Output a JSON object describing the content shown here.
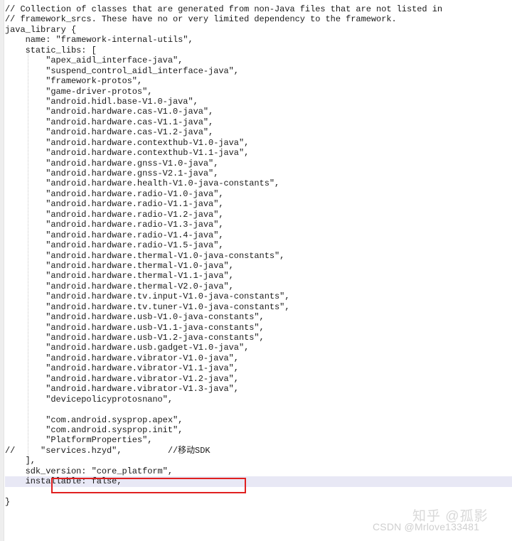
{
  "editor": {
    "language": "blueprint",
    "colors": {
      "background": "#ffffff",
      "text": "#1a1a1a",
      "gutter": "#eeeeee",
      "highlight_line": "#e8e8f5",
      "annotation_box": "#e02020",
      "indent_guide": "#c9c9c9",
      "watermark": "#d9d9d9"
    },
    "highlighted_line_index": 46,
    "annotation": {
      "type": "red-rectangle",
      "target_line_index": 46,
      "note": "commented-out services.hzyd entry"
    },
    "lines": [
      "// Collection of classes that are generated from non-Java files that are not listed in",
      "// framework_srcs. These have no or very limited dependency to the framework.",
      "java_library {",
      "    name: \"framework-internal-utils\",",
      "    static_libs: [",
      "        \"apex_aidl_interface-java\",",
      "        \"suspend_control_aidl_interface-java\",",
      "        \"framework-protos\",",
      "        \"game-driver-protos\",",
      "        \"android.hidl.base-V1.0-java\",",
      "        \"android.hardware.cas-V1.0-java\",",
      "        \"android.hardware.cas-V1.1-java\",",
      "        \"android.hardware.cas-V1.2-java\",",
      "        \"android.hardware.contexthub-V1.0-java\",",
      "        \"android.hardware.contexthub-V1.1-java\",",
      "        \"android.hardware.gnss-V1.0-java\",",
      "        \"android.hardware.gnss-V2.1-java\",",
      "        \"android.hardware.health-V1.0-java-constants\",",
      "        \"android.hardware.radio-V1.0-java\",",
      "        \"android.hardware.radio-V1.1-java\",",
      "        \"android.hardware.radio-V1.2-java\",",
      "        \"android.hardware.radio-V1.3-java\",",
      "        \"android.hardware.radio-V1.4-java\",",
      "        \"android.hardware.radio-V1.5-java\",",
      "        \"android.hardware.thermal-V1.0-java-constants\",",
      "        \"android.hardware.thermal-V1.0-java\",",
      "        \"android.hardware.thermal-V1.1-java\",",
      "        \"android.hardware.thermal-V2.0-java\",",
      "        \"android.hardware.tv.input-V1.0-java-constants\",",
      "        \"android.hardware.tv.tuner-V1.0-java-constants\",",
      "        \"android.hardware.usb-V1.0-java-constants\",",
      "        \"android.hardware.usb-V1.1-java-constants\",",
      "        \"android.hardware.usb-V1.2-java-constants\",",
      "        \"android.hardware.usb.gadget-V1.0-java\",",
      "        \"android.hardware.vibrator-V1.0-java\",",
      "        \"android.hardware.vibrator-V1.1-java\",",
      "        \"android.hardware.vibrator-V1.2-java\",",
      "        \"android.hardware.vibrator-V1.3-java\",",
      "        \"devicepolicyprotosnano\",",
      "",
      "        \"com.android.sysprop.apex\",",
      "        \"com.android.sysprop.init\",",
      "        \"PlatformProperties\",",
      "//     \"services.hzyd\",         //移动SDK",
      "    ],",
      "    sdk_version: \"core_platform\",",
      "    installable: false,",
      "",
      "}"
    ]
  },
  "watermarks": {
    "zhihu": "知乎 @孤影",
    "csdn": "CSDN @Mrlove133481"
  }
}
